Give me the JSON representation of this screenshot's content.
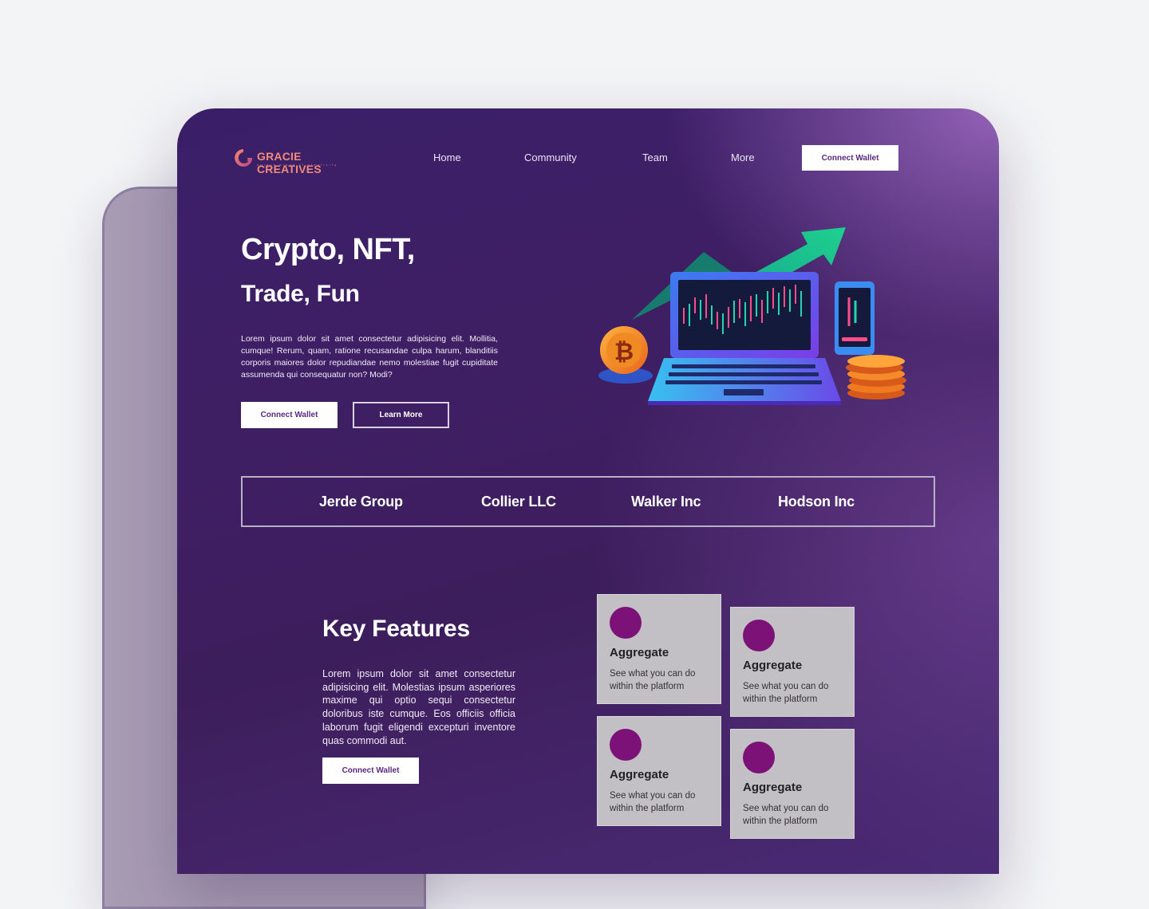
{
  "brand": {
    "name": "GRACIE CREATIVES",
    "tagline": "unique blend of creativity"
  },
  "nav": {
    "items": [
      "Home",
      "Community",
      "Team",
      "More"
    ],
    "cta": "Connect Wallet"
  },
  "hero": {
    "title": "Crypto, NFT,",
    "subtitle": "Trade, Fun",
    "body": "Lorem ipsum dolor sit amet consectetur adipisicing elit. Mollitia, cumque! Rerum, quam, ratione recusandae culpa harum, blanditiis corporis maiores dolor repudiandae nemo molestiae fugit cupiditate assumenda qui consequatur non? Modi?",
    "primary_button": "Connect Wallet",
    "secondary_button": "Learn More"
  },
  "partners": [
    "Jerde Group",
    "Collier LLC",
    "Walker Inc",
    "Hodson Inc"
  ],
  "key_features": {
    "title": "Key Features",
    "body": "Lorem ipsum dolor sit amet consectetur adipisicing elit. Molestias ipsum asperiores maxime qui optio sequi consectetur doloribus iste cumque. Eos officiis officia laborum fugit eligendi excepturi inventore quas commodi aut.",
    "button": "Connect Wallet",
    "cards": [
      {
        "title": "Aggregate",
        "desc": "See what you can do within the platform"
      },
      {
        "title": "Aggregate",
        "desc": "See what you can do within the platform"
      },
      {
        "title": "Aggregate",
        "desc": "See what you can do within the platform"
      },
      {
        "title": "Aggregate",
        "desc": "See what you can do within the platform"
      }
    ]
  },
  "colors": {
    "background": "#f3f4f6",
    "frame_dark": "#3a1f68",
    "frame_light": "#9d6bc4",
    "button_text": "#5a2a82",
    "card_bg": "#c2c0c5",
    "card_dot": "#7c1277",
    "logo": "#f08a7a"
  },
  "icons": {
    "logo": "letter-g-logo-icon",
    "illustration": "crypto-laptop-illustration"
  }
}
